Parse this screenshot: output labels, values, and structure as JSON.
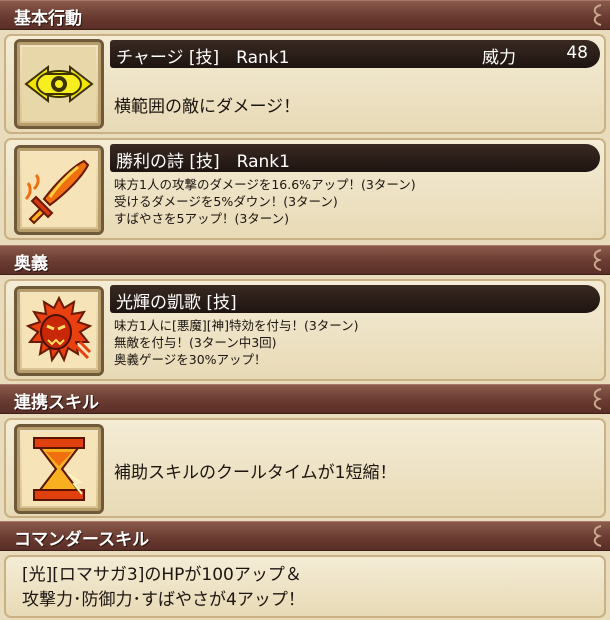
{
  "sections": {
    "basic": "基本行動",
    "ougi": "奥義",
    "renkei": "連携スキル",
    "commander": "コマンダースキル"
  },
  "skills": {
    "charge": {
      "name": "チャージ [技]　Rank1",
      "power_label": "威力",
      "power_value": "48",
      "desc": "横範囲の敵にダメージ！",
      "icon": "eye-sigil-icon"
    },
    "victory": {
      "name": "勝利の詩 [技]　Rank1",
      "lines": [
        "味方1人の攻撃のダメージを16.6%アップ！(3ターン)",
        "受けるダメージを5%ダウン！(3ターン)",
        "すばやさを5アップ！(3ターン)"
      ],
      "icon": "flaming-sword-icon"
    },
    "radiant": {
      "name": "光輝の凱歌 [技]",
      "lines": [
        "味方1人に[悪魔][神]特効を付与！(3ターン)",
        "無敵を付与！(3ターン中3回)",
        "奥義ゲージを30%アップ！"
      ],
      "icon": "demon-face-icon"
    },
    "link": {
      "desc": "補助スキルのクールタイムが1短縮！",
      "icon": "hourglass-icon"
    }
  },
  "commander": {
    "lines": [
      "[光][ロマサガ3]のHPが100アップ＆",
      "攻撃力･防御力･すばやさが4アップ！"
    ]
  },
  "colors": {
    "header": "#6a3b31",
    "card": "#efe3c6",
    "title_bar": "#2a1d17",
    "icon_accent": "#e03a10"
  }
}
